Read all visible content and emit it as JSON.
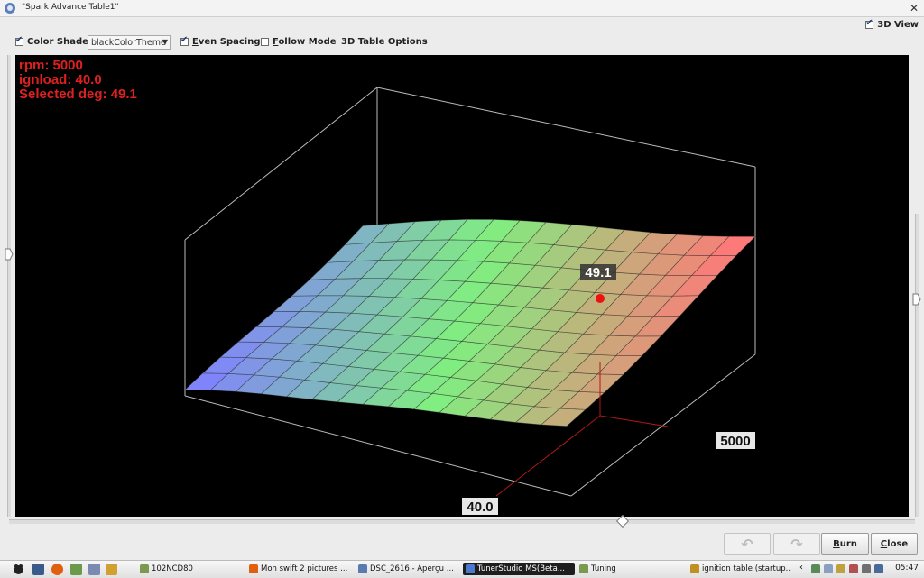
{
  "window": {
    "title": "\"Spark Advance Table1\""
  },
  "view3d": {
    "label": "3D View",
    "checked": true
  },
  "toolbar": {
    "color_shade": {
      "label": "Color Shade",
      "checked": true
    },
    "theme": {
      "value": "blackColorTheme"
    },
    "even_spacing": {
      "label": "Even Spacing",
      "underline": "E",
      "rest": "ven Spacing",
      "checked": true
    },
    "follow_mode": {
      "label": "Follow Mode",
      "underline": "F",
      "rest": "ollow Mode",
      "checked": false
    },
    "table_options": {
      "label": "3D Table Options"
    }
  },
  "readout": {
    "rpm": "rpm: 5000",
    "load": "ignload: 40.0",
    "selected": "Selected deg: 49.1",
    "color": "#e02020"
  },
  "plot": {
    "selected_value": "49.1",
    "rpm_axis_value": "5000",
    "load_axis_value": "40.0",
    "low_color": "#8080ff",
    "mid_color": "#80ee80",
    "high_color": "#ff7878",
    "point_color": "#ee1111",
    "selection_line_color": "#b01818"
  },
  "buttons": {
    "undo_glyph": "↶",
    "redo_glyph": "↷",
    "burn": {
      "label": "Burn",
      "underline": "B",
      "rest": "urn"
    },
    "close": {
      "label": "Close",
      "underline": "C",
      "rest": "lose"
    }
  },
  "taskbar": {
    "tasks": [
      {
        "label": "102NCD80",
        "active": false,
        "icon_color": "#7a9a50"
      },
      {
        "label": "Mon swift 2 pictures ...",
        "active": false,
        "icon_color": "#e06010"
      },
      {
        "label": "DSC_2616 - Aperçu ...",
        "active": false,
        "icon_color": "#5a7ab0"
      },
      {
        "label": "TunerStudio MS(Beta...",
        "active": true,
        "icon_color": "#4a7ad0"
      },
      {
        "label": "Tuning",
        "active": false,
        "icon_color": "#7a9a50"
      },
      {
        "label": "ignition table (startup...",
        "active": false,
        "icon_color": "#c09020"
      }
    ],
    "clock": "05:47"
  }
}
